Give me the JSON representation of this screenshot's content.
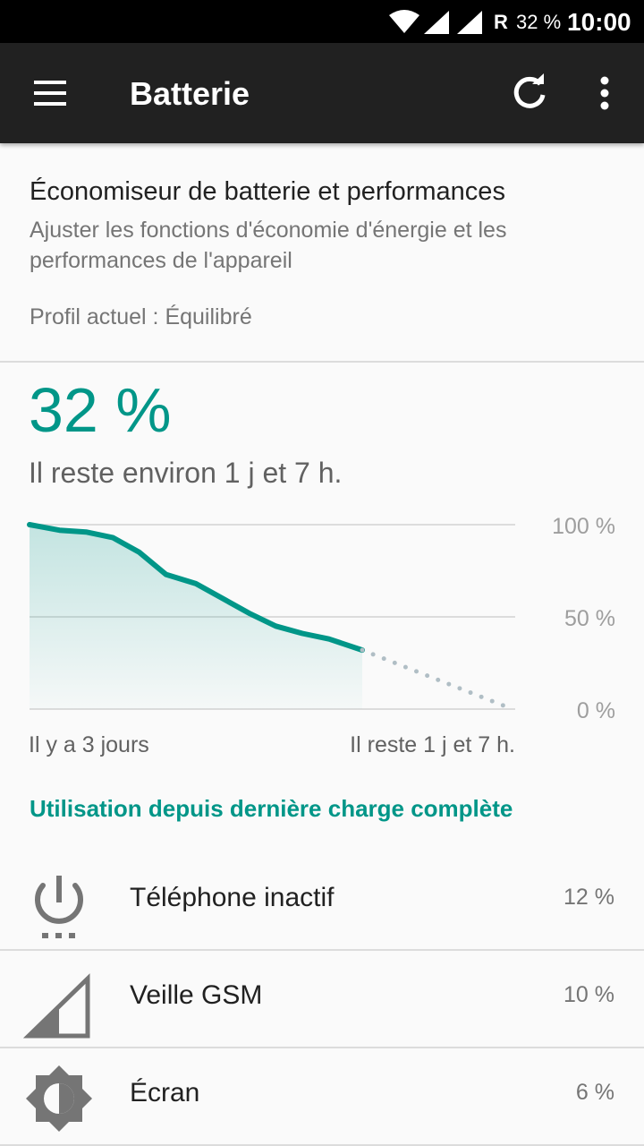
{
  "status_bar": {
    "roaming": "R",
    "battery": "32 %",
    "time": "10:00"
  },
  "app_bar": {
    "title": "Batterie",
    "icons": [
      "menu-icon",
      "refresh-icon",
      "more-vert-icon"
    ]
  },
  "saver": {
    "title": "Économiseur de batterie et performances",
    "description": "Ajuster les fonctions d'économie d'énergie et les performances de l'appareil",
    "profile": "Profil actuel : Équilibré"
  },
  "battery": {
    "percent": "32 %",
    "remaining": "Il reste environ 1 j et 7 h."
  },
  "chart_data": {
    "type": "area",
    "y_tick_labels": [
      "100 %",
      "50 %",
      "0 %"
    ],
    "ylim": [
      0,
      100
    ],
    "x_labels": [
      "Il y a 3 jours",
      "Il reste 1 j et 7 h."
    ],
    "series": [
      {
        "values": [
          [
            0,
            100
          ],
          [
            0.03,
            99
          ],
          [
            0.09,
            97
          ],
          [
            0.17,
            96
          ],
          [
            0.25,
            93
          ],
          [
            0.33,
            85
          ],
          [
            0.41,
            73
          ],
          [
            0.5,
            68
          ],
          [
            0.58,
            60
          ],
          [
            0.66,
            52
          ],
          [
            0.74,
            45
          ],
          [
            0.82,
            41
          ],
          [
            0.9,
            38
          ],
          [
            1.0,
            32
          ]
        ]
      },
      {
        "style": "dotted-prediction",
        "values": [
          [
            1.0,
            32
          ],
          [
            2.0,
            0
          ]
        ]
      }
    ],
    "grid": true
  },
  "usage": {
    "section_title": "Utilisation depuis dernière charge complète",
    "items": [
      {
        "icon": "power-idle-icon",
        "label": "Téléphone inactif",
        "percent": "12 %"
      },
      {
        "icon": "cell-signal-icon",
        "label": "Veille GSM",
        "percent": "10 %"
      },
      {
        "icon": "brightness-icon",
        "label": "Écran",
        "percent": "6 %"
      }
    ]
  },
  "colors": {
    "accent": "#009688",
    "app_bar": "#212121",
    "status_bar": "#000000",
    "prediction_dots": "#b0bec5"
  }
}
